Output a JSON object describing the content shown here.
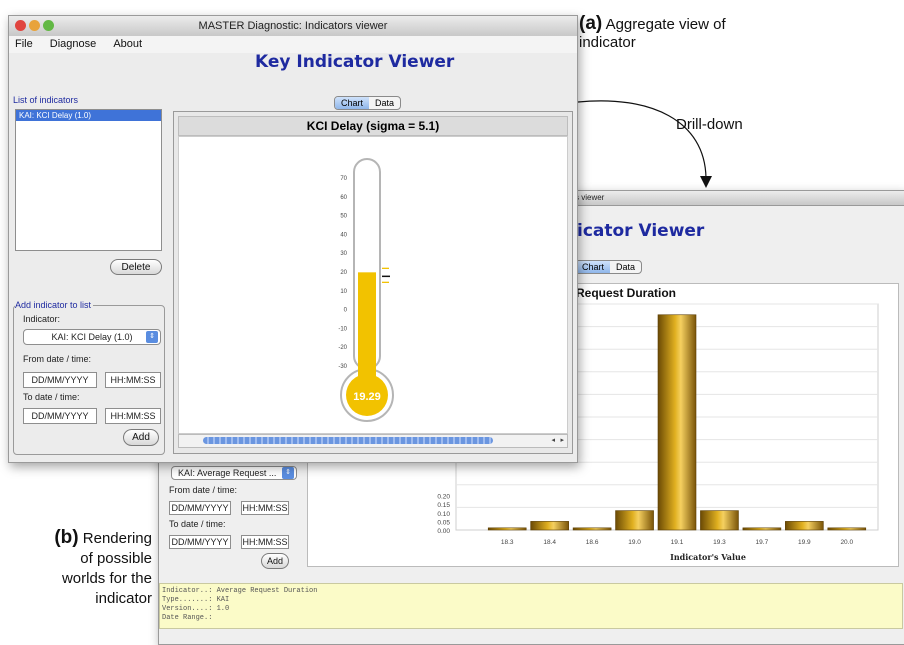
{
  "annotations": {
    "a_letter": "(a)",
    "a_text_1": "Aggregate view of",
    "a_text_2": "indicator",
    "drilldown": "Drill-down",
    "b_letter": "(b)",
    "b_text_1": "Rendering",
    "b_text_2": "of possible",
    "b_text_3": "worlds for the",
    "b_text_4": "indicator"
  },
  "window_a": {
    "title": "MASTER Diagnostic: Indicators viewer",
    "menu": [
      "File",
      "Diagnose",
      "About"
    ],
    "heading": "Key Indicator Viewer",
    "list_title": "List of indicators",
    "list_items": [
      "KAI: KCI Delay (1.0)"
    ],
    "delete_label": "Delete",
    "add_group_title": "Add indicator to list",
    "indicator_label": "Indicator:",
    "indicator_value": "KAI: KCI Delay (1.0)",
    "from_label": "From date / time:",
    "to_label": "To date / time:",
    "date_placeholder": "DD/MM/YYYY",
    "time_placeholder": "HH:MM:SS",
    "add_label": "Add",
    "tabs": [
      "Chart",
      "Data"
    ],
    "chart_title": "KCI Delay (sigma = 5.1)"
  },
  "window_b": {
    "title_fragment": "s viewer",
    "heading_fragment": "icator Viewer",
    "tabs": [
      "Chart",
      "Data"
    ],
    "chart_title_fragment": "Request Duration",
    "indicator_value": "KAI: Average Request ...",
    "from_label": "From date / time:",
    "to_label": "To date / time:",
    "date_placeholder": "DD/MM/YYYY",
    "time_placeholder": "HH:MM:SS",
    "add_label": "Add",
    "info_lines": [
      "Indicator..: Average Request Duration",
      "Type.......: KAI",
      "Version....: 1.0",
      "Date Range.:"
    ]
  },
  "chart_data": [
    {
      "type": "gauge",
      "title": "KCI Delay (sigma = 5.1)",
      "ticks": [
        70,
        60,
        50,
        40,
        30,
        20,
        10,
        0,
        -10,
        -20,
        -30
      ],
      "ylim": [
        -30,
        70
      ],
      "value": 19.29,
      "value_label": "19.29",
      "fill_color": "#f2c200"
    },
    {
      "type": "bar",
      "title": "Request Duration",
      "xlabel": "Indicator's Value",
      "categories": [
        "18.3",
        "18.4",
        "18.6",
        "19.0",
        "19.1",
        "19.3",
        "19.7",
        "19.9",
        "20.0"
      ],
      "values": [
        0.01,
        0.04,
        0.01,
        0.09,
        1.0,
        0.09,
        0.01,
        0.04,
        0.01
      ],
      "ytick_labels": [
        "0.00",
        "0.05",
        "0.10",
        "0.15",
        "0.20"
      ],
      "ylim": [
        0,
        1.05
      ],
      "bar_color": "#b8860b"
    }
  ]
}
